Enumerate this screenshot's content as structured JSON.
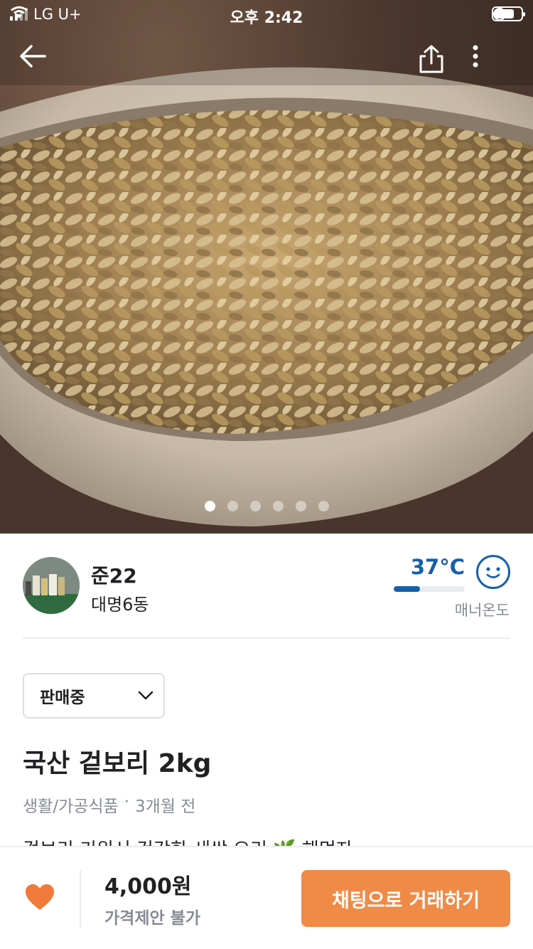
{
  "status_bar": {
    "carrier": "LG U+",
    "time": "오후 2:42",
    "battery_level": 0.75
  },
  "header": {
    "back_icon": "arrow-left-icon",
    "share_icon": "share-icon",
    "more_icon": "more-vertical-icon"
  },
  "gallery": {
    "image_count": 6,
    "active_index": 0
  },
  "profile": {
    "nickname": "준22",
    "region": "대명6동",
    "temperature": "37°C",
    "temperature_value": 37,
    "temperature_label": "매너온도",
    "temperature_color": "#1561a9"
  },
  "product": {
    "status": "판매중",
    "title": "국산 겉보리 2kg",
    "category": "생활/가공식품",
    "separator": "·",
    "posted": "3개월 전",
    "description": "겉보리 키워서 건강한 새싹 오리 🌿 해먹자"
  },
  "bottom_bar": {
    "price": "4,000원",
    "negotiation": "가격제안 불가",
    "chat_button": "채팅으로 거래하기",
    "accent_color": "#ef8b47"
  }
}
